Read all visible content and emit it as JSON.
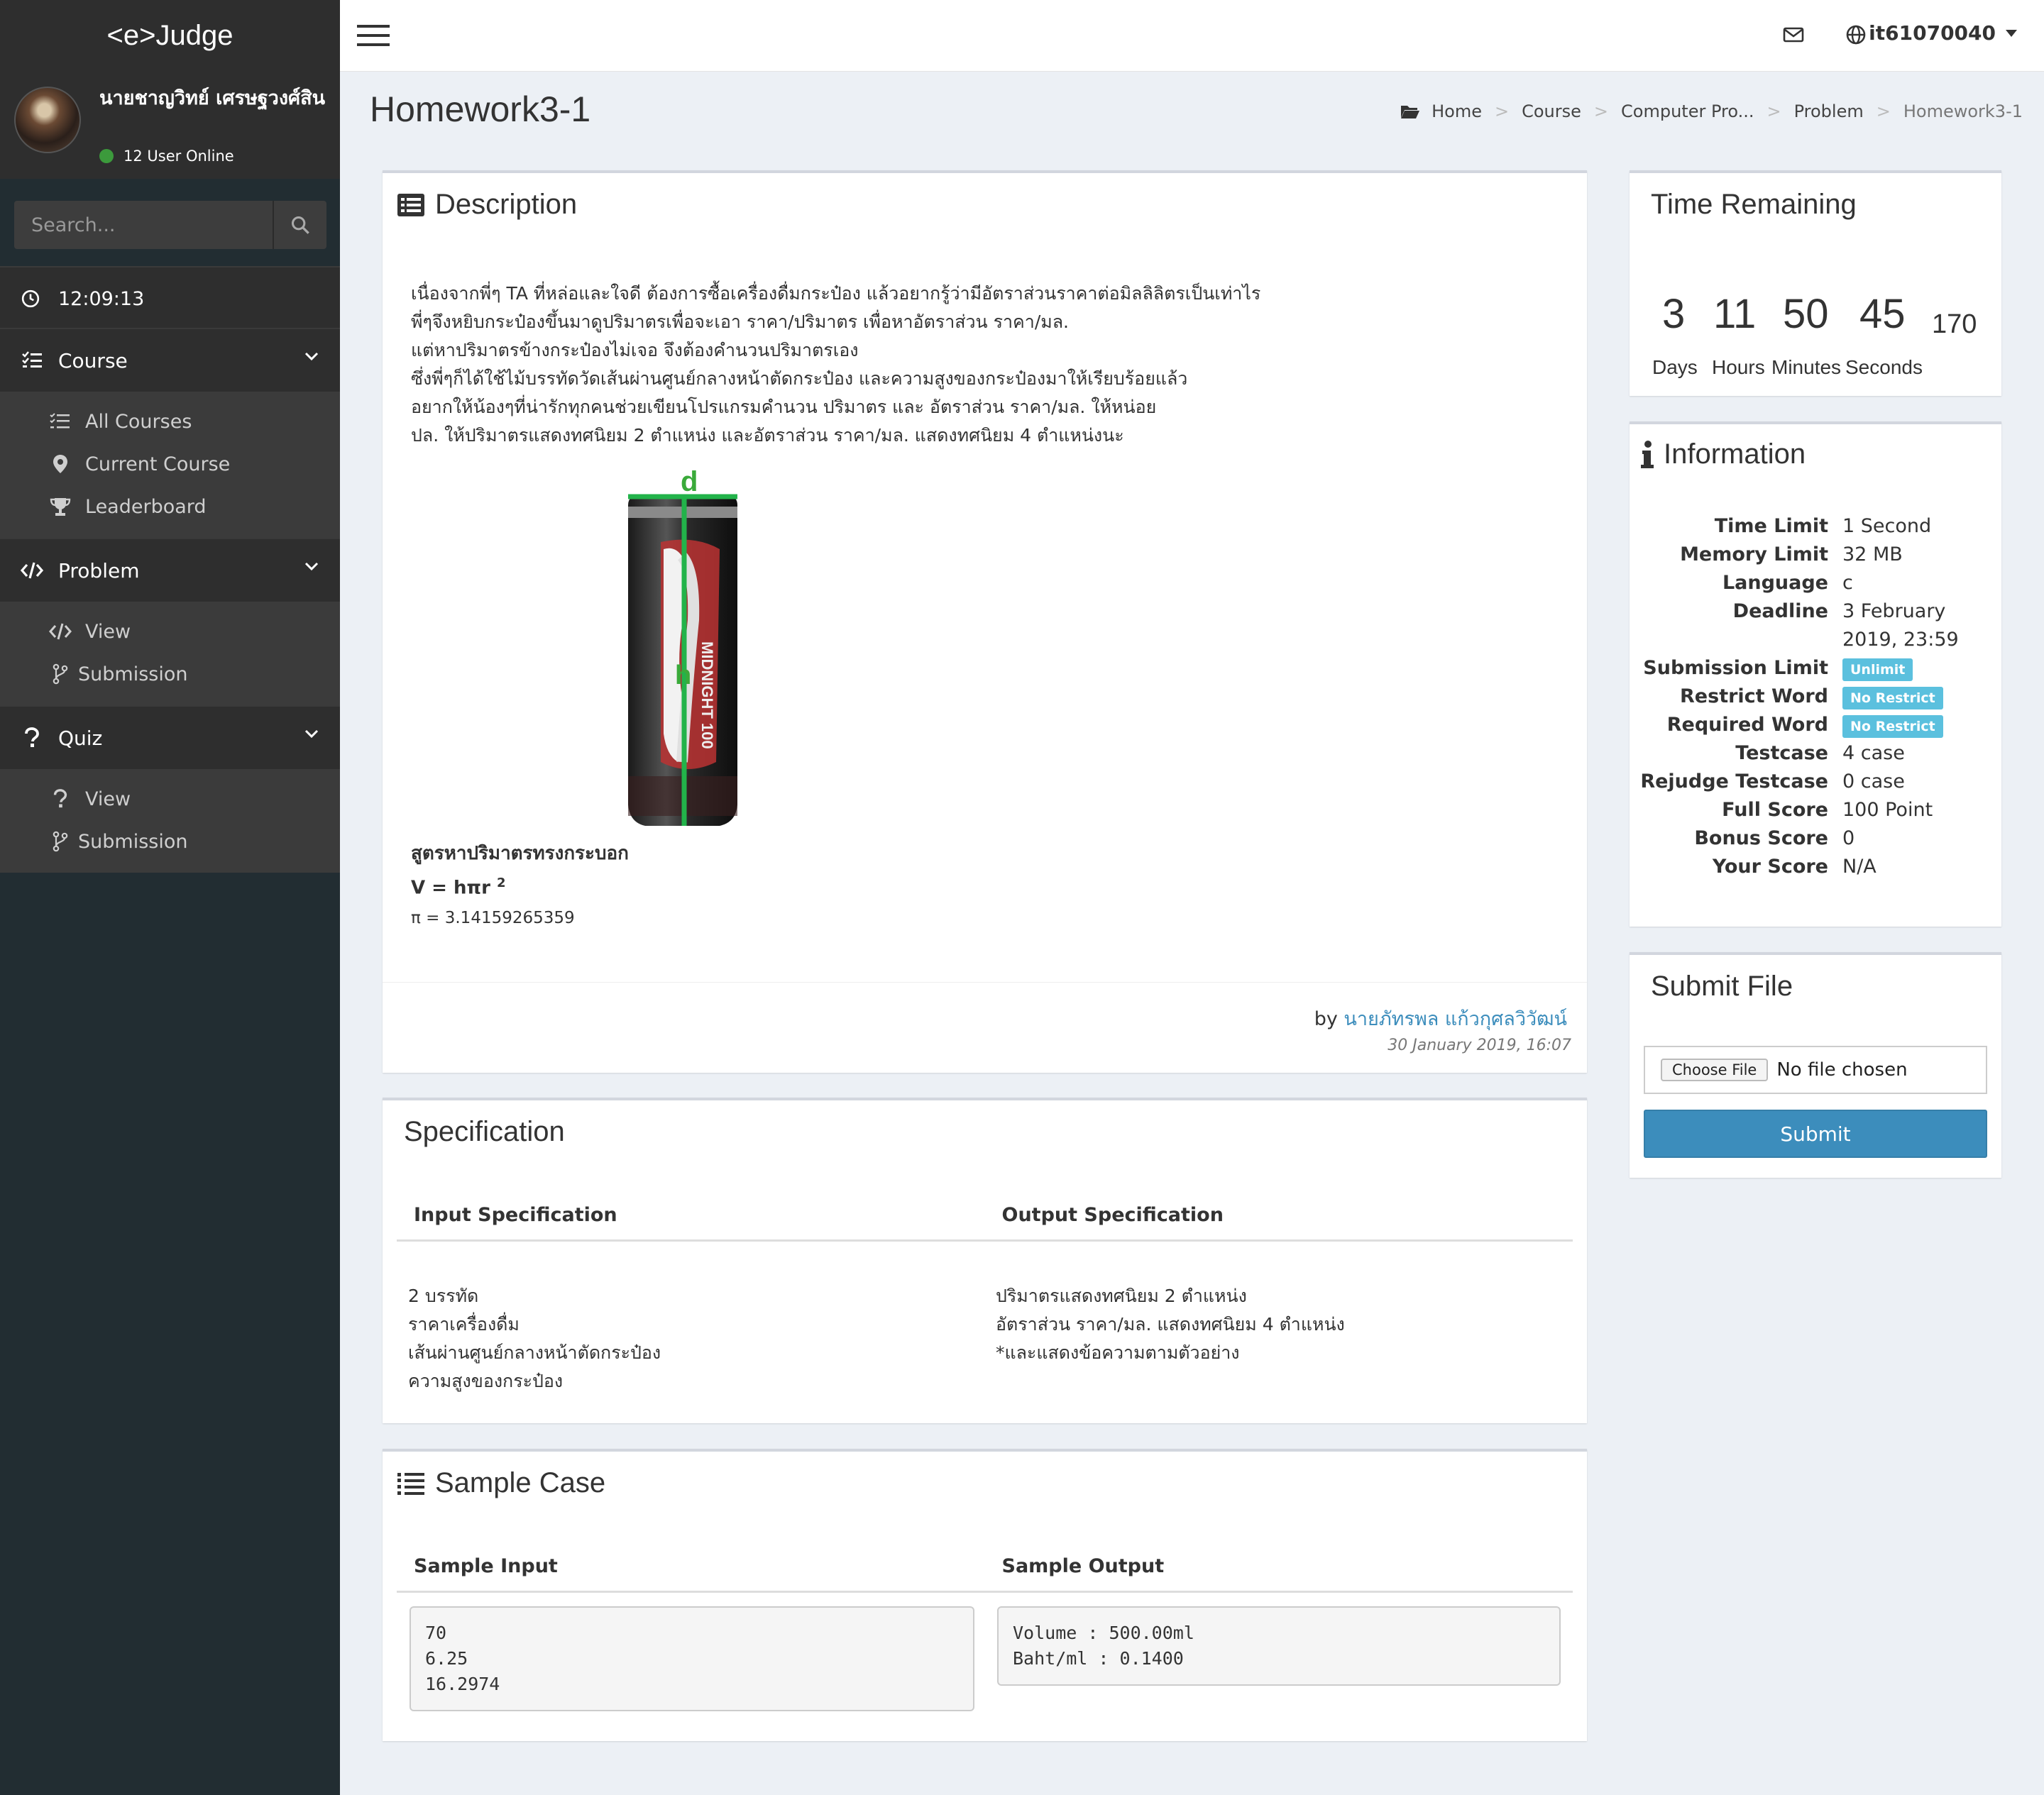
{
  "brand": "<e>Judge",
  "user": {
    "name": "นายชาญวิทย์ เศรษฐวงศ์สิน",
    "online": "12 User Online"
  },
  "search": {
    "placeholder": "Search..."
  },
  "clock": "12:09:13",
  "menu": {
    "course": {
      "label": "Course",
      "items": [
        "All Courses",
        "Current Course",
        "Leaderboard"
      ]
    },
    "problem": {
      "label": "Problem",
      "items": [
        "View",
        "Submission"
      ]
    },
    "quiz": {
      "label": "Quiz",
      "items": [
        "View",
        "Submission"
      ]
    }
  },
  "topbar": {
    "username": "it61070040"
  },
  "page": {
    "title": "Homework3-1",
    "breadcrumb": [
      "Home",
      "Course",
      "Computer Pro...",
      "Problem",
      "Homework3-1"
    ]
  },
  "description": {
    "title": "Description",
    "lines": [
      "เนื่องจากพี่ๆ TA ที่หล่อและใจดี ต้องการซื้อเครื่องดื่มกระป๋อง แล้วอยากรู้ว่ามีอัตราส่วนราคาต่อมิลลิลิตรเป็นเท่าไร",
      "พี่ๆจึงหยิบกระป๋องขึ้นมาดูปริมาตรเพื่อจะเอา ราคา/ปริมาตร เพื่อหาอัตราส่วน ราคา/มล.",
      "แต่หาปริมาตรข้างกระป๋องไม่เจอ จึงต้องคำนวนปริมาตรเอง",
      "ซึ่งพี่ๆก็ได้ใช้ไม้บรรทัดวัดเส้นผ่านศูนย์กลางหน้าตัดกระป๋อง และความสูงของกระป๋องมาให้เรียบร้อยแล้ว",
      "อยากให้น้องๆที่น่ารักทุกคนช่วยเขียนโปรแกรมคำนวน ปริมาตร และ อัตราส่วน ราคา/มล. ให้หน่อย",
      "ปล. ให้ปริมาตรแสดงทศนิยม 2 ตำแหน่ง และอัตราส่วน ราคา/มล. แสดงทศนิยม 4 ตำแหน่งนะ"
    ],
    "image_labels": {
      "diameter": "d",
      "height": "h"
    },
    "formula_title": "สูตรหาปริมาตรทรงกระบอก",
    "formula": "V = hπr",
    "formula_exp": "2",
    "pi": "π = 3.14159265359",
    "by": "by",
    "author": "นายภัทรพล แก้วกุศลวิวัฒน์",
    "date": "30 January 2019, 16:07"
  },
  "specification": {
    "title": "Specification",
    "input_header": "Input Specification",
    "output_header": "Output Specification",
    "input_lines": [
      "2 บรรทัด",
      "ราคาเครื่องดื่ม",
      "เส้นผ่านศูนย์กลางหน้าตัดกระป๋อง",
      "ความสูงของกระป๋อง"
    ],
    "output_lines": [
      "ปริมาตรแสดงทศนิยม 2 ตำแหน่ง",
      "อัตราส่วน ราคา/มล. แสดงทศนิยม 4 ตำแหน่ง",
      "*และแสดงข้อความตามตัวอย่าง"
    ]
  },
  "sample": {
    "title": "Sample Case",
    "input_header": "Sample Input",
    "output_header": "Sample Output",
    "input": "70\n6.25\n16.2974",
    "output": "Volume : 500.00ml\nBaht/ml : 0.1400"
  },
  "time_remaining": {
    "title": "Time Remaining",
    "days": "3",
    "hours": "11",
    "minutes": "50",
    "seconds": "45",
    "extra": "170",
    "labels": [
      "Days",
      "Hours",
      "Minutes",
      "Seconds"
    ]
  },
  "information": {
    "title": "Information",
    "time_limit_label": "Time Limit",
    "time_limit": "1 Second",
    "memory_limit_label": "Memory Limit",
    "memory_limit": "32 MB",
    "language_label": "Language",
    "language": "c",
    "deadline_label": "Deadline",
    "deadline_1": "3 February",
    "deadline_2": "2019, 23:59",
    "submission_limit_label": "Submission Limit",
    "submission_limit": "Unlimit",
    "restrict_word_label": "Restrict Word",
    "restrict_word": "No Restrict",
    "required_word_label": "Required Word",
    "required_word": "No Restrict",
    "testcase_label": "Testcase",
    "testcase": "4 case",
    "rejudge_label": "Rejudge Testcase",
    "rejudge": "0 case",
    "full_score_label": "Full Score",
    "full_score": "100 Point",
    "bonus_score_label": "Bonus Score",
    "bonus_score": "0",
    "your_score_label": "Your Score",
    "your_score": "N/A",
    "badge_color": "#5bc0de"
  },
  "submit_file": {
    "title": "Submit File",
    "choose": "Choose File",
    "chosen": "No file chosen",
    "submit": "Submit",
    "button_color": "#3c8dbc"
  }
}
